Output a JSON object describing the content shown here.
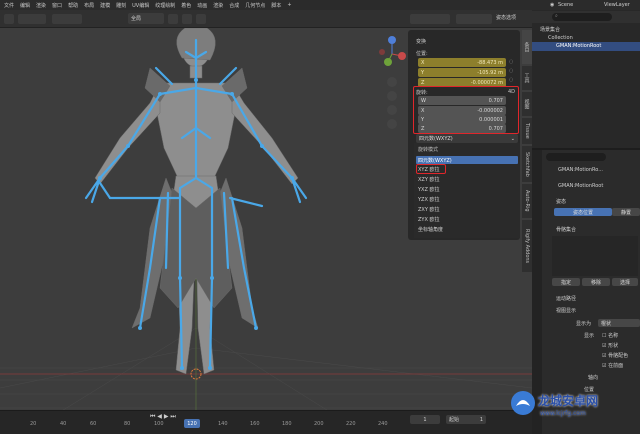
{
  "menu": [
    "文件",
    "编辑",
    "渲染",
    "窗口",
    "帮助",
    "",
    "布局",
    "建模",
    "雕刻",
    "UV编辑",
    "纹理绘制",
    "着色",
    "动画",
    "渲染",
    "合成",
    "几何节点",
    "脚本",
    "+"
  ],
  "header": {
    "view_mode": "全局",
    "scene": "Scene",
    "view_layer": "ViewLayer",
    "pose_options": "姿态选项"
  },
  "npanel": {
    "section_transform": "变换",
    "location_label": "位置:",
    "location": [
      {
        "axis": "X",
        "value": "-88.473 m"
      },
      {
        "axis": "Y",
        "value": "-105.92 m"
      },
      {
        "axis": "Z",
        "value": "-0.000072 m"
      }
    ],
    "rotation_label": "旋转:",
    "rotation_suffix": "4D",
    "rotation": [
      {
        "axis": "W",
        "value": "0.707"
      },
      {
        "axis": "X",
        "value": "-0.000002"
      },
      {
        "axis": "Y",
        "value": "0.000001"
      },
      {
        "axis": "Z",
        "value": "0.707"
      }
    ],
    "rotation_mode_value": "四元数(WXYZ)",
    "dropdown_title": "旋转模式",
    "dropdown_items": [
      "四元数(WXYZ)",
      "XYZ 欧拉",
      "XZY 欧拉",
      "YXZ 欧拉",
      "YZX 欧拉",
      "ZXY 欧拉",
      "ZYX 欧拉",
      "坐标轴角度"
    ]
  },
  "side_tabs": [
    "条目",
    "工具",
    "视图",
    "Tissue",
    "Sketchfab",
    "Auto-Rig",
    "Rigify Addons"
  ],
  "outliner": {
    "items": [
      "场景集合",
      "Collection",
      "GMAN:MotionRoot"
    ]
  },
  "properties": {
    "object_name": "GMAN:MotionRo...",
    "bone_name": "GMAN:MotionRoot",
    "section_pose": "姿态",
    "pose_position": "姿态位置",
    "rest_position": "静置",
    "section_bone_collections": "骨骼集合",
    "assign": "指定",
    "remove": "移除",
    "select": "选择",
    "section_motion_paths": "运动路径",
    "section_viewport_display": "视图显示",
    "display_as_label": "显示为",
    "display_as": "棍状",
    "show_label": "显示",
    "name": "名称",
    "shape": "形状",
    "bone_colors": "骨骼配色",
    "in_front": "在前面",
    "axes_label": "轴向",
    "position_label": "位置"
  },
  "timeline": {
    "ticks": [
      "20",
      "40",
      "60",
      "80",
      "100",
      "120",
      "140",
      "160",
      "180",
      "200",
      "220",
      "240"
    ],
    "current_frame": "120",
    "frame_field": "1",
    "start_label": "起始",
    "start_value": "1"
  },
  "watermark": {
    "brand": "龙城安卓网",
    "url": "www.lcjrfg.com"
  },
  "colors": {
    "accent": "#4772b3",
    "bone": "#4aa8e8",
    "highlight_red": "#e0262b",
    "yellow_field": "#8d7f2c"
  }
}
